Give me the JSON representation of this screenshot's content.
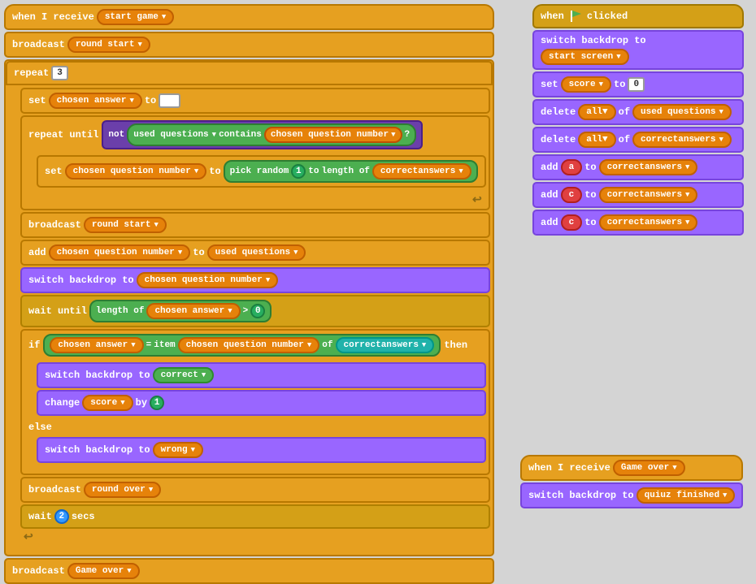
{
  "left_stack": {
    "block1_label": "when I receive",
    "block1_var": "start game",
    "block2_label": "broadcast",
    "block2_var": "round start",
    "block3_label": "repeat",
    "block3_num": "3",
    "set_label": "set",
    "set_var": "chosen answer",
    "set_to": "to",
    "repeat_until_label": "repeat until",
    "not_label": "not",
    "used_questions": "used questions",
    "contains_label": "contains",
    "chosen_question_number": "chosen question number",
    "set_inner_label": "set",
    "set_inner_var": "chosen question number",
    "pick_random_label": "pick random",
    "pick_random_1": "1",
    "to_label": "to",
    "length_of_label": "length of",
    "correctanswers": "correctanswers",
    "broadcast2_label": "broadcast",
    "broadcast2_var": "round start",
    "add_label": "add",
    "add_var": "chosen question number",
    "add_to_label": "to",
    "add_to_var": "used questions",
    "switch_label": "switch backdrop to",
    "switch_var": "chosen question number",
    "wait_until_label": "wait until",
    "length_of2_label": "length of",
    "chosen_answer2": "chosen answer",
    "gt_label": ">",
    "gt_val": "0",
    "if_label": "if",
    "chosen_answer3": "chosen answer",
    "eq_label": "=",
    "item_label": "item",
    "cqn_label": "chosen question number",
    "of_label": "of",
    "correctanswers2": "correctanswers",
    "then_label": "then",
    "switch_correct_label": "switch backdrop to",
    "correct_val": "correct",
    "change_label": "change",
    "score_var": "score",
    "by_label": "by",
    "by_val": "1",
    "else_label": "else",
    "switch_wrong_label": "switch backdrop to",
    "wrong_val": "wrong",
    "broadcast_round_over_label": "broadcast",
    "broadcast_round_over_var": "round over",
    "wait_label": "wait",
    "wait_num": "2",
    "wait_secs": "secs",
    "broadcast_game_over_label": "broadcast",
    "broadcast_game_over_var": "Game over"
  },
  "right_stack1": {
    "when_clicked": "when",
    "clicked_label": "clicked",
    "switch_label": "switch backdrop to",
    "switch_var": "start screen",
    "set_score_label": "set",
    "score_var": "score",
    "to_label": "to",
    "score_val": "0",
    "delete1_label": "delete",
    "all1_label": "all▼",
    "of1_label": "of",
    "used_questions": "used questions",
    "delete2_label": "delete",
    "all2_label": "all▼",
    "of2_label": "of",
    "correctanswers": "correctanswers",
    "add_a_label": "add",
    "a_val": "a",
    "to1_label": "to",
    "correctanswers1": "correctanswers",
    "add_c1_label": "add",
    "c1_val": "c",
    "to2_label": "to",
    "correctanswers2": "correctanswers",
    "add_c2_label": "add",
    "c2_val": "c",
    "to3_label": "to",
    "correctanswers3": "correctanswers"
  },
  "right_stack2": {
    "when_receive_label": "when I receive",
    "game_over_var": "Game over",
    "switch_label": "switch backdrop to",
    "switch_var": "quiuz finished"
  }
}
